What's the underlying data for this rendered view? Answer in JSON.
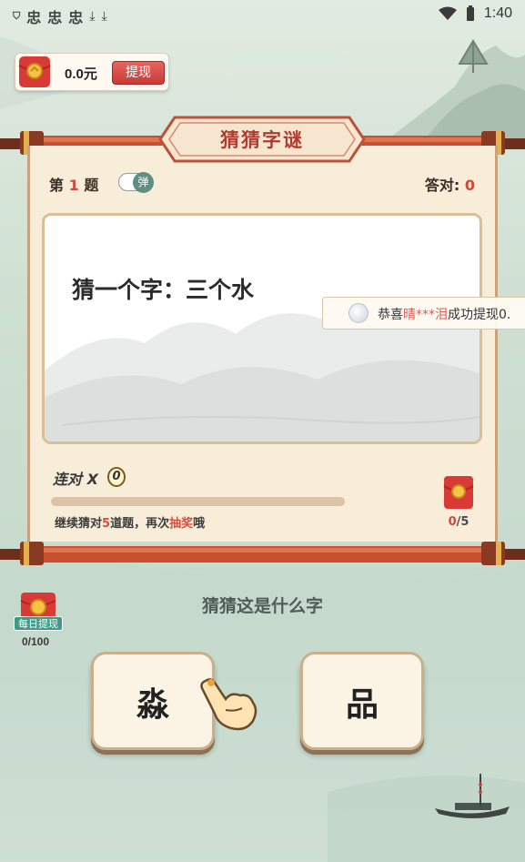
{
  "status_bar": {
    "time": "1:40",
    "left_icons": [
      "shield-icon",
      "app-icon",
      "app-icon",
      "app-icon",
      "download-icon",
      "download-icon"
    ],
    "right_icons": [
      "wifi-icon",
      "battery-icon"
    ]
  },
  "wallet": {
    "amount": "0.0元",
    "withdraw_label": "提现"
  },
  "header": {
    "title": "猜猜字谜"
  },
  "question": {
    "label_prefix": "第",
    "number": "1",
    "label_suffix": "题",
    "toggle_label": "弹",
    "correct_label": "答对:",
    "correct_count": "0",
    "riddle": "猜一个字：三个水"
  },
  "notice": {
    "prefix": "恭喜",
    "name": "晴***泪",
    "suffix": "成功提现0."
  },
  "streak": {
    "label": "连对",
    "x": "X",
    "count": "0"
  },
  "progress": {
    "fraction": 0,
    "hint_a": "继续猜对",
    "hint_num": "5",
    "hint_b": "道题，再次",
    "hint_red": "抽奖",
    "hint_c": "哦",
    "reward_done": "0",
    "reward_total": "/5"
  },
  "daily": {
    "badge": "每日提现",
    "count": "0/100"
  },
  "prompt": "猜猜这是什么字",
  "answers": [
    "淼",
    "品"
  ],
  "colors": {
    "accent_red": "#d04a3c",
    "scroll_wood": "#c8502f",
    "teal": "#3f9a86"
  }
}
